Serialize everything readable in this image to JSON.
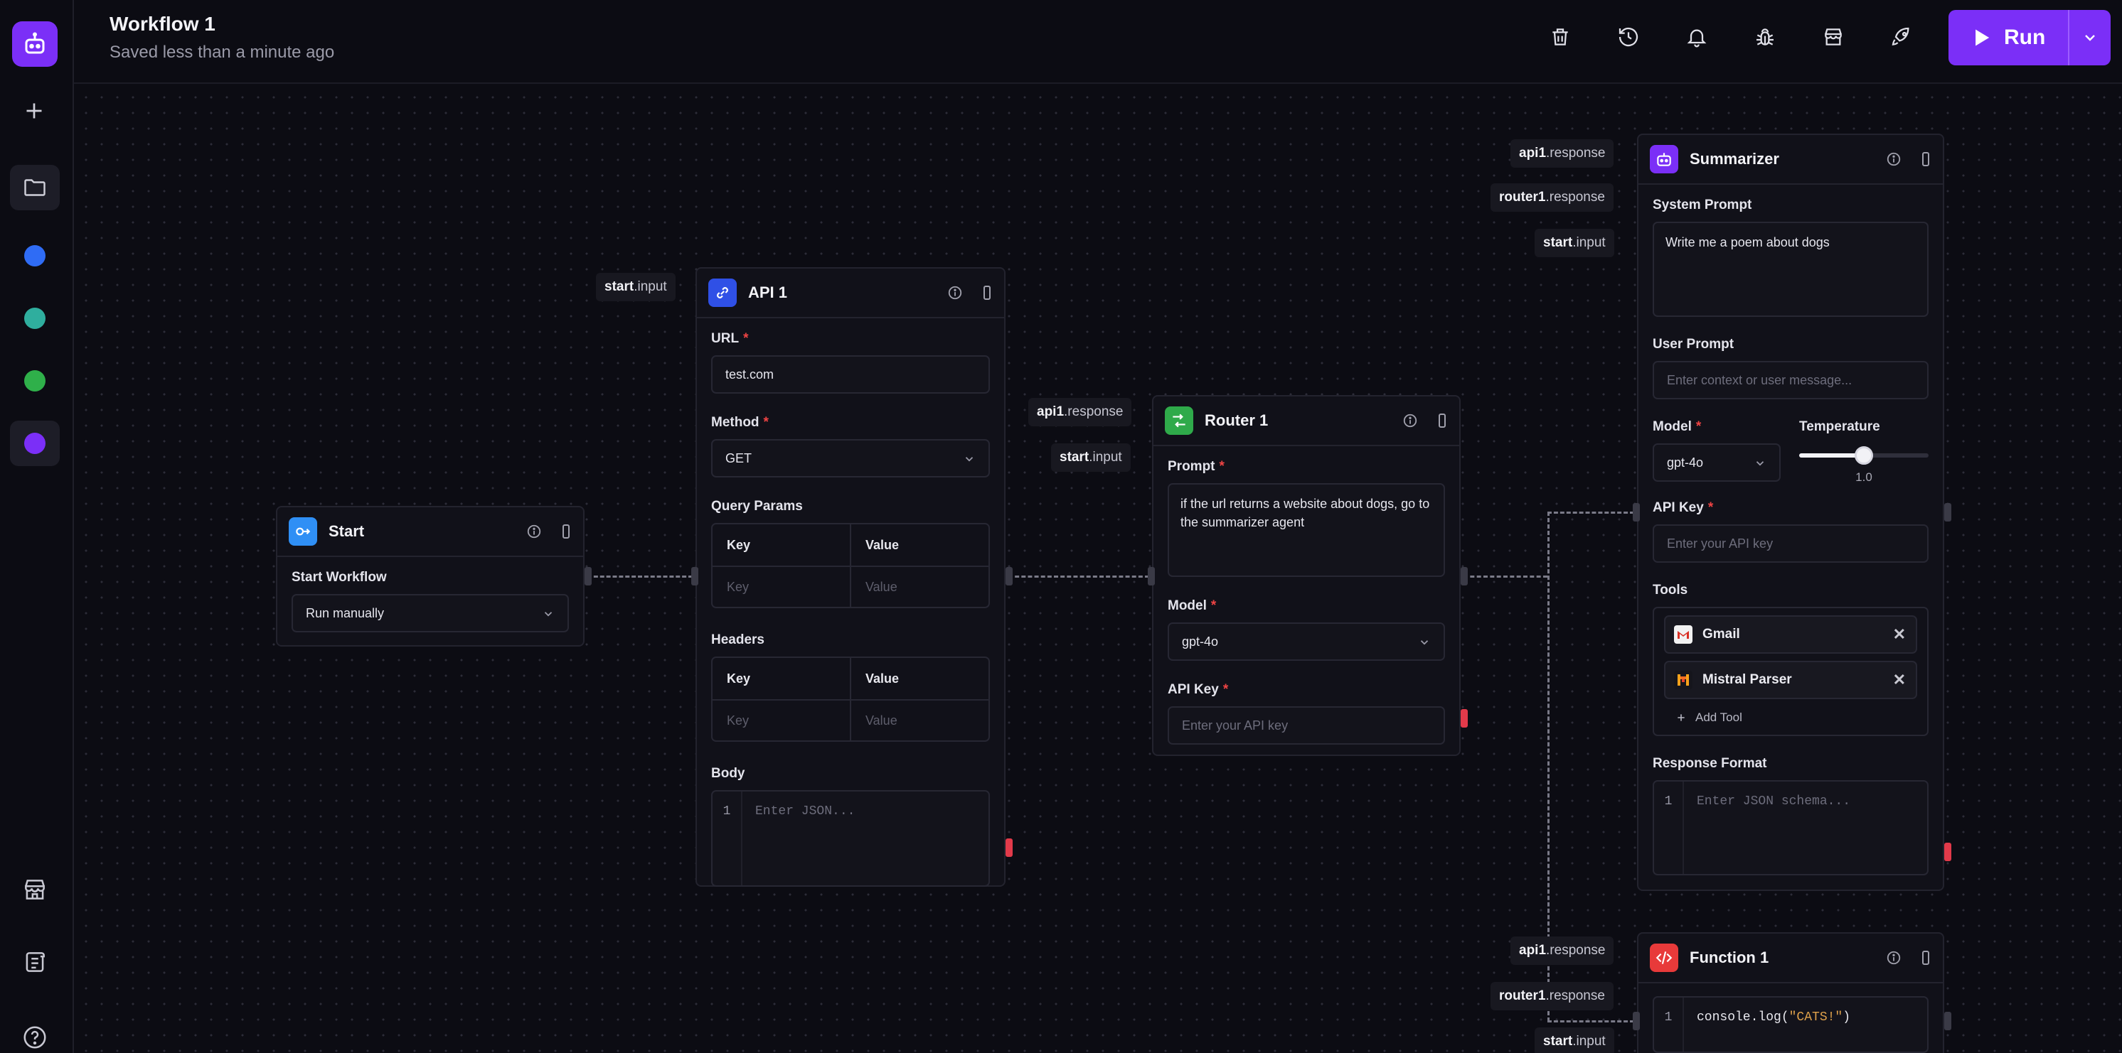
{
  "app": {
    "workflow_title": "Workflow 1",
    "save_status": "Saved less than a minute ago",
    "run_label": "Run"
  },
  "sidebar": {
    "workspace_dots": [
      {
        "color": "#2f6cf5"
      },
      {
        "color": "#2fae9e"
      },
      {
        "color": "#2fb04a"
      },
      {
        "color": "#7b2ff7"
      }
    ]
  },
  "nodes": {
    "start": {
      "title": "Start",
      "field_label": "Start Workflow",
      "trigger_value": "Run manually"
    },
    "api1": {
      "title": "API 1",
      "url_label": "URL",
      "url_value": "test.com",
      "method_label": "Method",
      "method_value": "GET",
      "query_label": "Query Params",
      "headers_label": "Headers",
      "key_header": "Key",
      "value_header": "Value",
      "key_placeholder": "Key",
      "value_placeholder": "Value",
      "body_label": "Body",
      "line_number": "1",
      "body_placeholder": "Enter JSON..."
    },
    "router1": {
      "title": "Router 1",
      "prompt_label": "Prompt",
      "prompt_value": "if the url returns a website about dogs, go to the summarizer agent",
      "model_label": "Model",
      "model_value": "gpt-4o",
      "apikey_label": "API Key",
      "apikey_placeholder": "Enter your API key"
    },
    "summarizer": {
      "title": "Summarizer",
      "system_prompt_label": "System Prompt",
      "system_prompt_value": "Write me a poem about dogs",
      "user_prompt_label": "User Prompt",
      "user_prompt_placeholder": "Enter context or user message...",
      "model_label": "Model",
      "model_value": "gpt-4o",
      "temperature_label": "Temperature",
      "temperature_value": "1.0",
      "temperature_fraction": 0.5,
      "apikey_label": "API Key",
      "apikey_placeholder": "Enter your API key",
      "tools_label": "Tools",
      "tools": [
        {
          "name": "Gmail",
          "icon": "gmail-icon"
        },
        {
          "name": "Mistral Parser",
          "icon": "mistral-icon"
        }
      ],
      "add_tool_label": "Add Tool",
      "response_format_label": "Response Format",
      "line_number": "1",
      "response_format_placeholder": "Enter JSON schema..."
    },
    "function1": {
      "title": "Function 1",
      "line_number": "1",
      "code_prefix": "console.log(",
      "code_string": "\"CATS!\"",
      "code_suffix": ")"
    }
  },
  "chips": {
    "api1_start": {
      "node": "start",
      "field": ".input"
    },
    "router_api1": {
      "node": "api1",
      "field": ".response"
    },
    "router_start": {
      "node": "start",
      "field": ".input"
    },
    "sum_api1": {
      "node": "api1",
      "field": ".response"
    },
    "sum_router1": {
      "node": "router1",
      "field": ".response"
    },
    "sum_start": {
      "node": "start",
      "field": ".input"
    },
    "fn_api1": {
      "node": "api1",
      "field": ".response"
    },
    "fn_router1": {
      "node": "router1",
      "field": ".response"
    },
    "fn_start": {
      "node": "start",
      "field": ".input"
    }
  }
}
